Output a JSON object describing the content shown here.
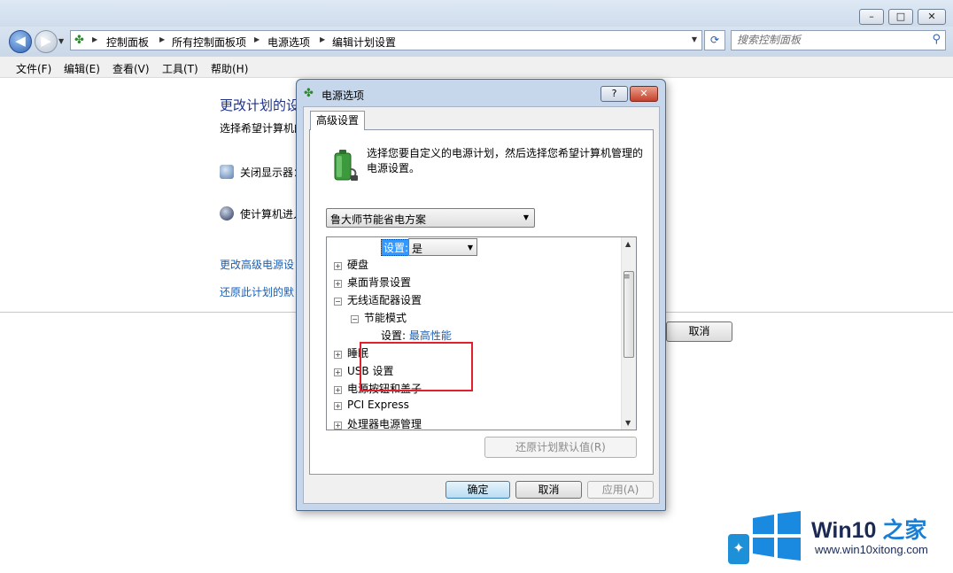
{
  "window": {
    "min_glyph": "–",
    "max_glyph": "□",
    "close_glyph": "✕"
  },
  "nav": {
    "back_glyph": "◀",
    "forward_glyph": "▶",
    "dropdown_glyph": "▼"
  },
  "address": {
    "crumbs": [
      "控制面板",
      "所有控制面板项",
      "电源选项",
      "编辑计划设置"
    ],
    "sep_glyph": "▶",
    "dropdown_glyph": "▼",
    "refresh_glyph": "⟳"
  },
  "search": {
    "placeholder": "搜索控制面板",
    "icon_glyph": "⚲"
  },
  "menubar": {
    "items": [
      "文件(F)",
      "编辑(E)",
      "查看(V)",
      "工具(T)",
      "帮助(H)"
    ]
  },
  "page": {
    "title": "更改计划的设",
    "subtitle": "选择希望计算机的",
    "options": [
      "关闭显示器：",
      "使计算机进入"
    ],
    "links": [
      "更改高级电源设",
      "还原此计划的默"
    ],
    "cancel_label": "取消"
  },
  "dialog": {
    "title": "电源选项",
    "help_glyph": "?",
    "close_glyph": "✕",
    "tab_label": "高级设置",
    "intro": "选择您要自定义的电源计划，然后选择您希望计算机管理的电源设置。",
    "plan_selected": "鲁大师节能省电方案",
    "tree_top": {
      "label": "设置:",
      "value": "是"
    },
    "tree": [
      {
        "label": "硬盘",
        "expander": "+"
      },
      {
        "label": "桌面背景设置",
        "expander": "+"
      },
      {
        "label": "无线适配器设置",
        "expander": "−"
      },
      {
        "label": "节能模式",
        "expander": "−"
      },
      {
        "label": "设置:",
        "value": "最高性能"
      },
      {
        "label": "睡眠",
        "expander": "+"
      },
      {
        "label": "USB 设置",
        "expander": "+"
      },
      {
        "label": "电源按钮和盖子",
        "expander": "+"
      },
      {
        "label": "PCI Express",
        "expander": "+"
      },
      {
        "label": "处理器电源管理",
        "expander": "+"
      }
    ],
    "restore_label": "还原计划默认值(R)",
    "ok_label": "确定",
    "cancel_label": "取消",
    "apply_label": "应用(A)",
    "highlight_color": "#e21f2c"
  },
  "watermark": {
    "brand_main": "Win10",
    "brand_accent": " 之家",
    "url": "www.win10xitong.com"
  }
}
